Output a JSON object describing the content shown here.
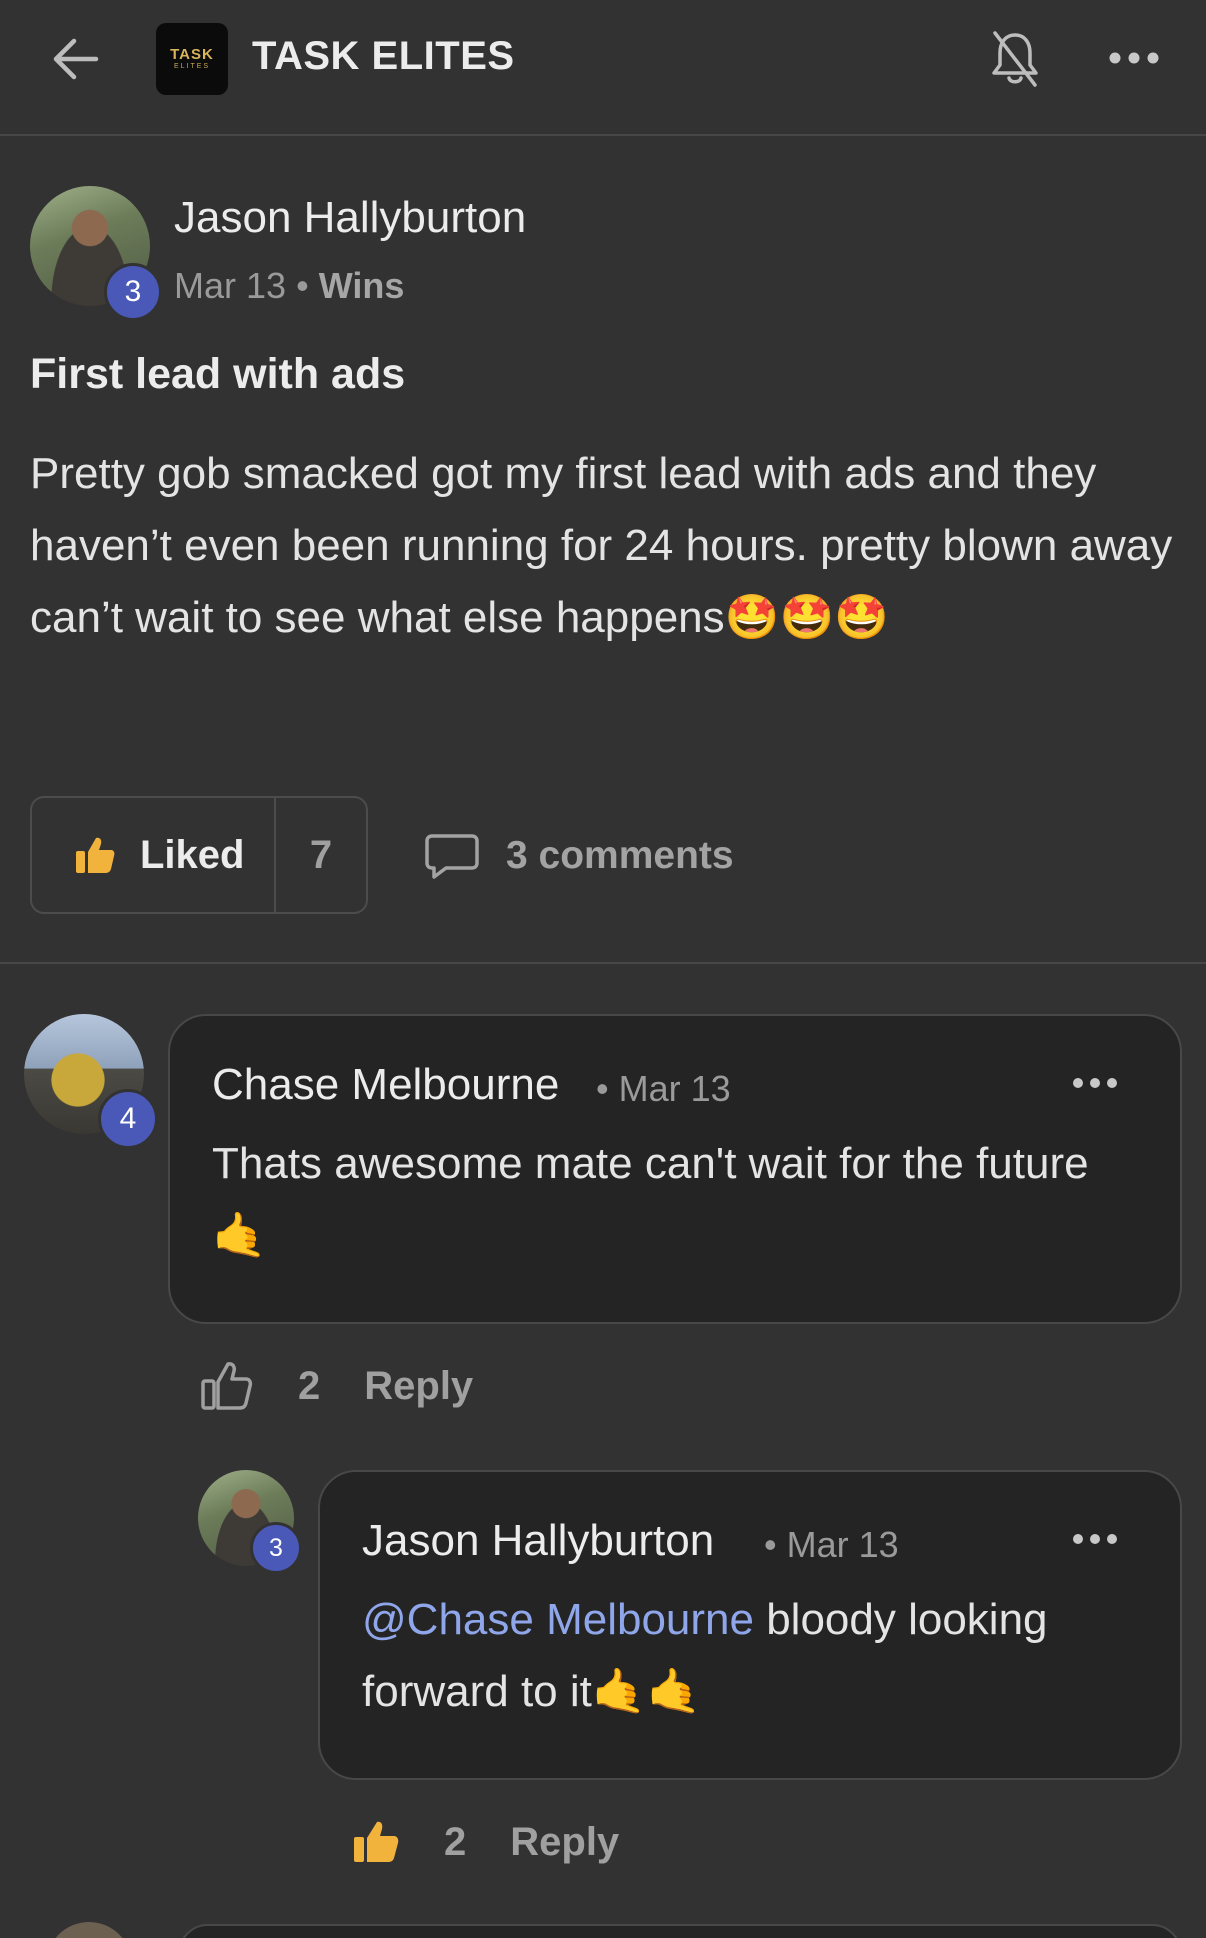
{
  "header": {
    "group_logo_line1": "TASK",
    "group_logo_line2": "ELITES",
    "group_name": "TASK ELITES",
    "icons": [
      "arrow-left-icon",
      "bell-off-icon",
      "more-horizontal-icon"
    ]
  },
  "post": {
    "author": "Jason Hallyburton",
    "level": "3",
    "date": "Mar 13",
    "separator": "•",
    "category": "Wins",
    "title": "First lead with ads",
    "body": "Pretty gob smacked got my first lead with ads and they haven’t even been running for 24 hours. pretty blown away can’t wait to see what else happens🤩🤩🤩",
    "like_label": "Liked",
    "like_count": "7",
    "comments_label": "3 comments"
  },
  "comments": [
    {
      "author": "Chase Melbourne",
      "level": "4",
      "date": "• Mar 13",
      "text": "Thats awesome mate can't wait for the future 🤙",
      "like_count": "2",
      "reply_label": "Reply"
    },
    {
      "author": "Jason Hallyburton",
      "level": "3",
      "date": "• Mar 13",
      "mention": "@Chase Melbourne",
      "text": " bloody looking forward to it🤙🤙",
      "like_count": "2",
      "reply_label": "Reply"
    }
  ],
  "colors": {
    "background": "#323232",
    "bubble": "#242424",
    "badge": "#4a58b8",
    "mention": "#8fa6ea",
    "like_active": "#f2b33d"
  }
}
